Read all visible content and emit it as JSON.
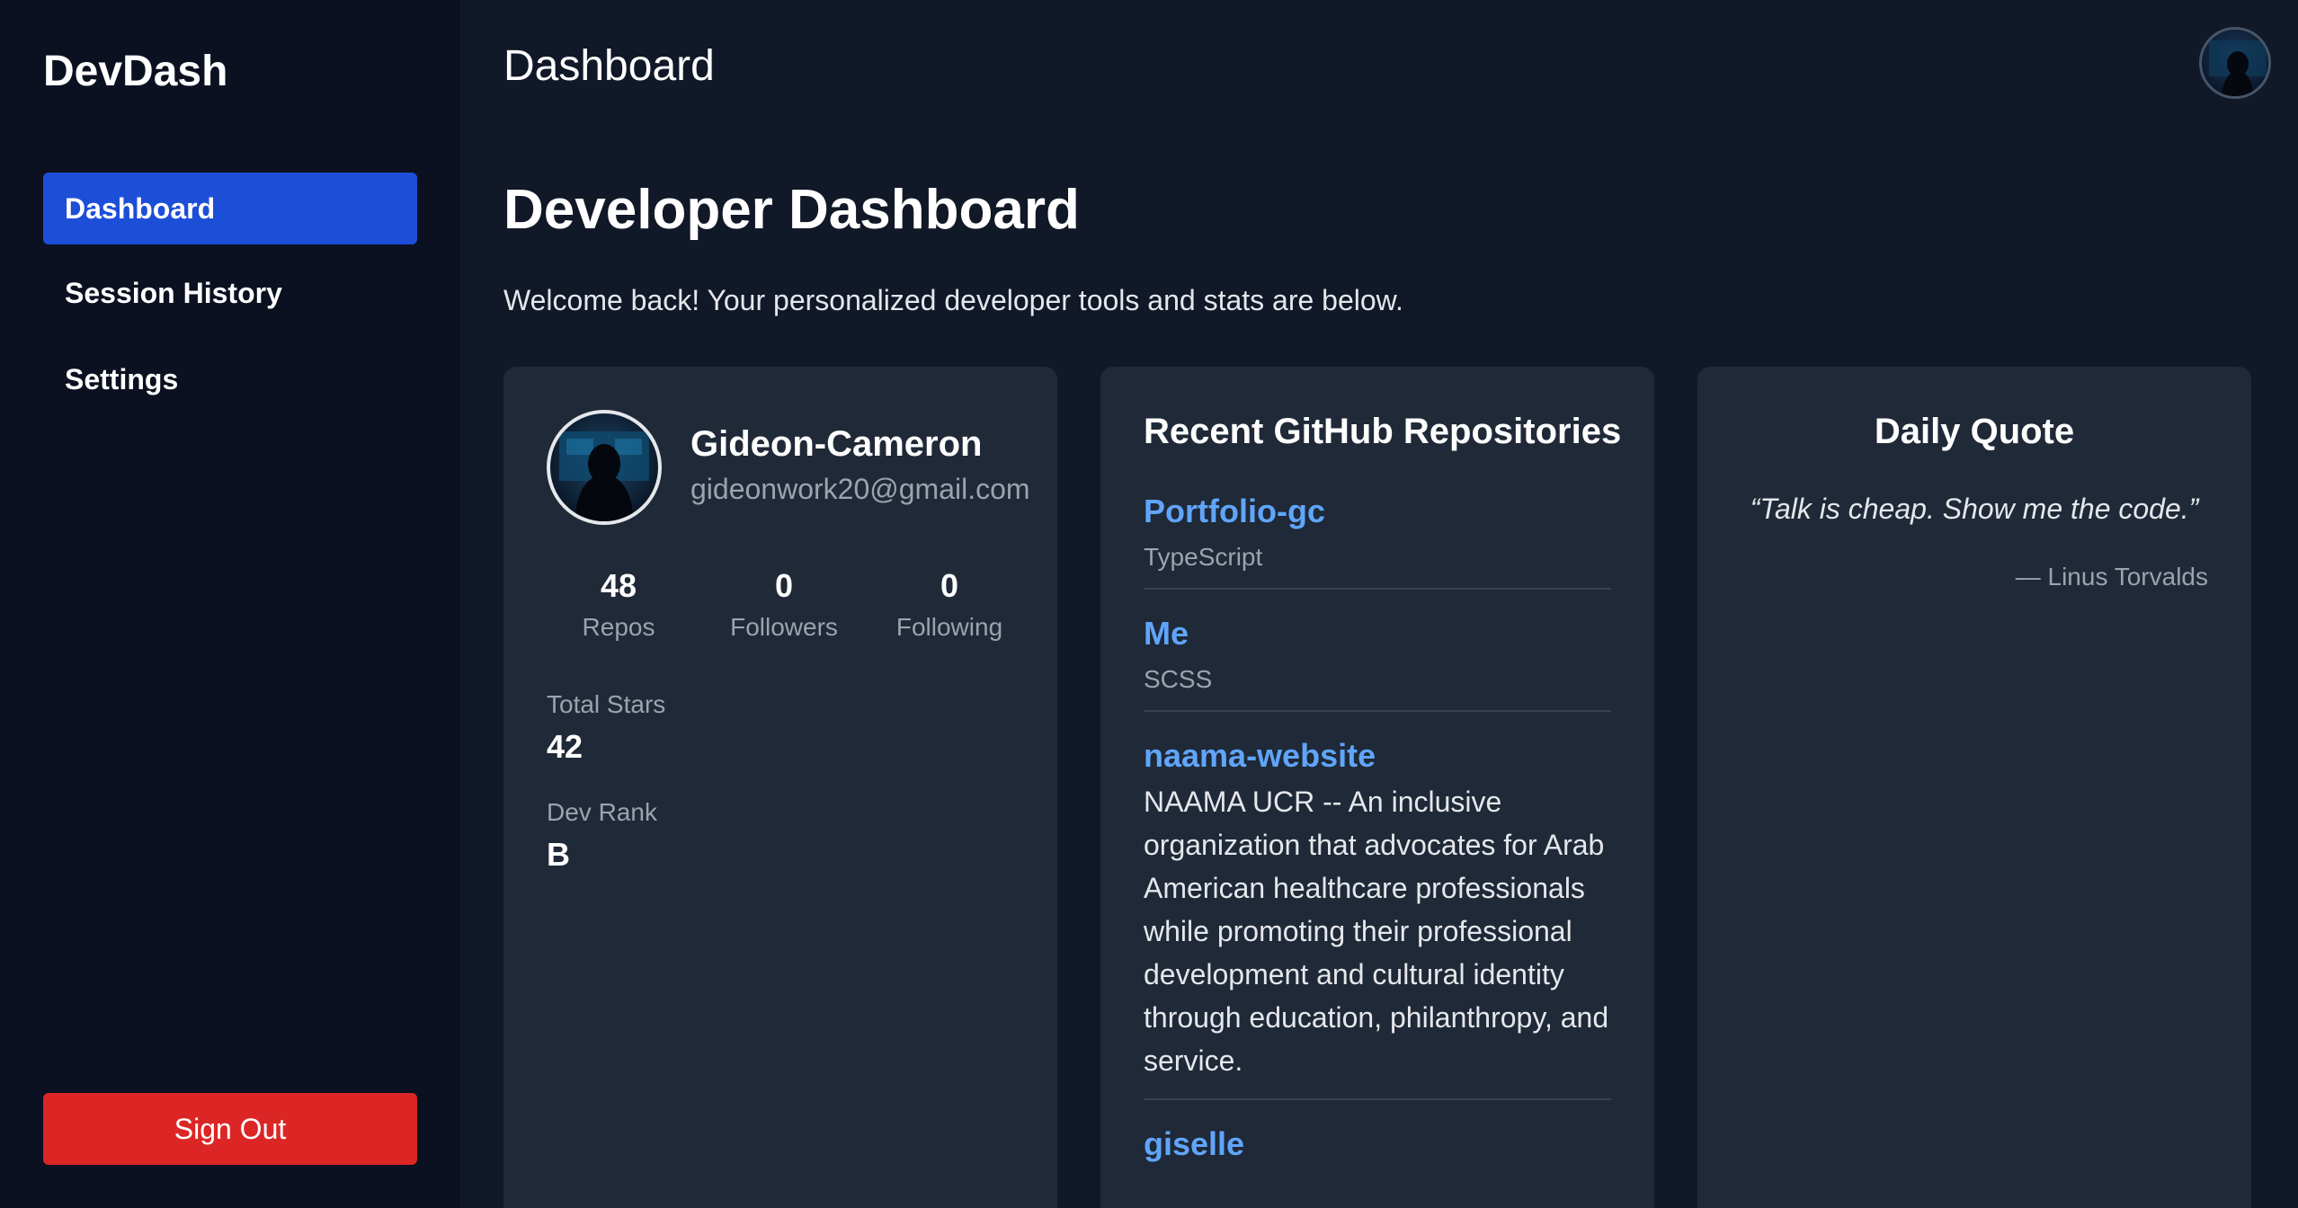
{
  "app": {
    "name": "DevDash"
  },
  "sidebar": {
    "items": [
      {
        "label": "Dashboard",
        "active": true
      },
      {
        "label": "Session History",
        "active": false
      },
      {
        "label": "Settings",
        "active": false
      }
    ],
    "sign_out_label": "Sign Out"
  },
  "header": {
    "title": "Dashboard"
  },
  "main": {
    "title": "Developer Dashboard",
    "welcome": "Welcome back! Your personalized developer tools and stats are below."
  },
  "profile": {
    "name": "Gideon-Cameron",
    "email": "gideonwork20@gmail.com",
    "stats": [
      {
        "value": "48",
        "label": "Repos"
      },
      {
        "value": "0",
        "label": "Followers"
      },
      {
        "value": "0",
        "label": "Following"
      }
    ],
    "total_stars_label": "Total Stars",
    "total_stars_value": "42",
    "dev_rank_label": "Dev Rank",
    "dev_rank_value": "B"
  },
  "repos": {
    "title": "Recent GitHub Repositories",
    "items": [
      {
        "name": "Portfolio-gc",
        "language": "TypeScript"
      },
      {
        "name": "Me",
        "language": "SCSS"
      },
      {
        "name": "naama-website",
        "description": "NAAMA UCR -- An inclusive organization that advocates for Arab American healthcare professionals while promoting their professional development and cultural identity through education, philanthropy, and service."
      },
      {
        "name": "giselle"
      }
    ]
  },
  "quote": {
    "title": "Daily Quote",
    "text": "“Talk is cheap. Show me the code.”",
    "author": "— Linus Torvalds"
  },
  "colors": {
    "accent": "#1d4ed8",
    "danger": "#dc2626",
    "link": "#60a5fa",
    "card_bg": "#1f2937",
    "sidebar_bg": "#0b1120"
  }
}
